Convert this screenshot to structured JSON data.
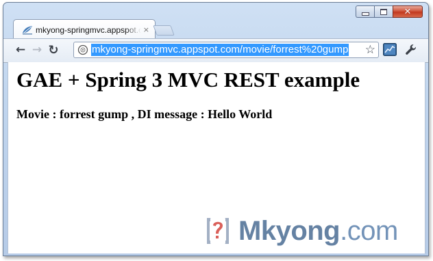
{
  "window": {
    "controls": {
      "minimize_icon": "minimize-icon",
      "maximize_icon": "maximize-icon",
      "close_glyph": "✕"
    }
  },
  "tab": {
    "title": "mkyong-springmvc.appspot.com",
    "close_glyph": "×",
    "favicon": "springmvc-leaf-icon"
  },
  "toolbar": {
    "back_glyph": "←",
    "forward_glyph": "→",
    "reload_glyph": "↻",
    "url": "mkyong-springmvc.appspot.com/movie/forrest%20gump",
    "star_glyph": "☆",
    "extension_icon": "chart-extension-icon",
    "menu_icon": "wrench-icon"
  },
  "page": {
    "heading": "GAE + Spring 3 MVC REST example",
    "message": "Movie : forrest gump , DI message : Hello World"
  },
  "watermark": {
    "brand_part1": "Mkyong",
    "brand_part2": ".com"
  },
  "colors": {
    "url_highlight": "#3399ff",
    "close_button": "#c2381f",
    "brand": "#3b5f8a"
  }
}
